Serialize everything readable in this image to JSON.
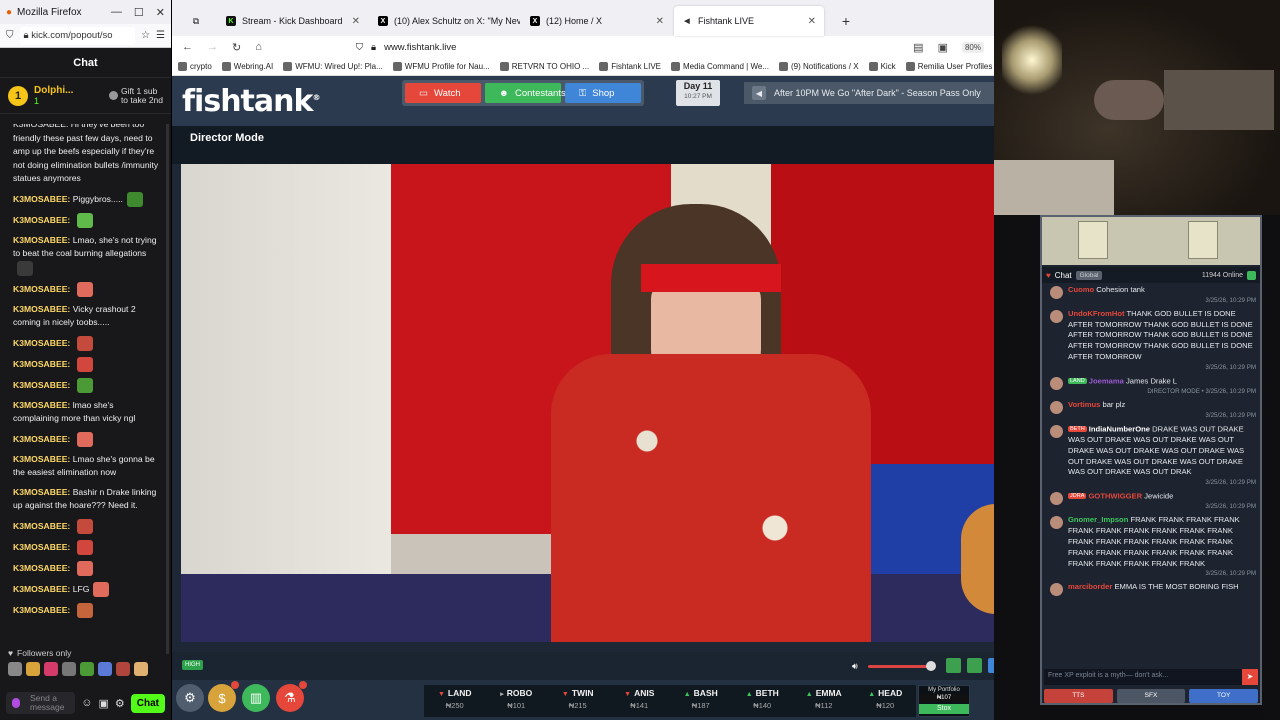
{
  "kick_window": {
    "title": "Mozilla Firefox",
    "url": "kick.com/popout/so",
    "header": "Chat",
    "pinned": {
      "badge": "1",
      "user": "Dolphi...",
      "count": "1",
      "gift_line1": "Gift 1 sub",
      "gift_line2": "to take 2nd"
    },
    "messages": [
      {
        "user": "",
        "text": "friendly these past few days, need to amp up the beefs especially if they're not doing elimination bullets /immunity statues anymores",
        "emote": "",
        "partial": "K3MOSABEE: Hi they've been too"
      },
      {
        "user": "K3MOSABEE:",
        "text": "Piggybros.....",
        "emote": "#3f8a2f"
      },
      {
        "user": "K3MOSABEE:",
        "text": "",
        "emote": "#5fba4a"
      },
      {
        "user": "K3MOSABEE:",
        "text": "Lmao, she's not trying to beat the coal burning allegations",
        "emote": "#3a3a3a"
      },
      {
        "user": "K3MOSABEE:",
        "text": "",
        "emote": "#e06b5c"
      },
      {
        "user": "K3MOSABEE:",
        "text": "Vicky crashout 2 coming in nicely toobs.....",
        "emote": ""
      },
      {
        "user": "K3MOSABEE:",
        "text": "",
        "emote": "#c44a3b"
      },
      {
        "user": "K3MOSABEE:",
        "text": "",
        "emote": "#d2473d"
      },
      {
        "user": "K3MOSABEE:",
        "text": "",
        "emote": "#4c9a36"
      },
      {
        "user": "K3MOSABEE:",
        "text": "lmao she's complaining more than vicky ngl",
        "emote": ""
      },
      {
        "user": "K3MOSABEE:",
        "text": "",
        "emote": "#e06b5c"
      },
      {
        "user": "K3MOSABEE:",
        "text": "Lmao she's gonna be the easiest elimination now",
        "emote": ""
      },
      {
        "user": "K3MOSABEE:",
        "text": "Bashir n Drake linking up against the hoare??? Need it.",
        "emote": ""
      },
      {
        "user": "K3MOSABEE:",
        "text": "",
        "emote": "#c44a3b"
      },
      {
        "user": "K3MOSABEE:",
        "text": "",
        "emote": "#d2473d"
      },
      {
        "user": "K3MOSABEE:",
        "text": "",
        "emote": "#e06b5c"
      },
      {
        "user": "K3MOSABEE:",
        "text": "LFG",
        "emote": "#e06b5c"
      },
      {
        "user": "K3MOSABEE:",
        "text": "",
        "emote": "#c4653b"
      }
    ],
    "followers_only": "Followers only",
    "send_placeholder": "Send a message",
    "chat_button": "Chat"
  },
  "main_window": {
    "tabs": [
      {
        "label": "Stream - Kick Dashboard",
        "icon": "K"
      },
      {
        "label": "(10) Alex Schultz on X: \"My Nev",
        "icon": "X"
      },
      {
        "label": "(12) Home / X",
        "icon": "X"
      },
      {
        "label": "Fishtank LIVE",
        "icon": "◀"
      }
    ],
    "url": "www.fishtank.live",
    "zoom": "80%",
    "bookmarks": [
      "crypto",
      "Webring.AI",
      "WFMU: Wired Up!: Pla...",
      "WFMU Profile for Nau...",
      "RETVRN TO OHIO ...",
      "Fishtank LIVE",
      "Media Command | We...",
      "(9) Notifications / X",
      "Kick",
      "Remilia User Profiles"
    ],
    "site": {
      "logo": "fishtank",
      "watch": "Watch",
      "contestants": "Contestants",
      "shop": "Shop",
      "day": "Day 11",
      "time": "10:27 PM",
      "ticker": "After 10PM We Go \"After Dark\" - Season Pass Only",
      "director_mode": "Director Mode",
      "hd": "HIGH"
    },
    "stocks": [
      {
        "name": "LAND",
        "price": "₦250",
        "dir": "down"
      },
      {
        "name": "ROBO",
        "price": "₦101",
        "dir": "flat"
      },
      {
        "name": "TWIN",
        "price": "₦215",
        "dir": "down"
      },
      {
        "name": "ANIS",
        "price": "₦141",
        "dir": "down"
      },
      {
        "name": "BASH",
        "price": "₦187",
        "dir": "up"
      },
      {
        "name": "BETH",
        "price": "₦140",
        "dir": "up"
      },
      {
        "name": "EMMA",
        "price": "₦112",
        "dir": "up"
      },
      {
        "name": "HEAD",
        "price": "₦120",
        "dir": "up"
      }
    ],
    "portfolio": {
      "label": "My Portfolio",
      "value": "₦107",
      "button": "Stox"
    }
  },
  "fishtank_chat": {
    "title": "Chat",
    "global": "Global",
    "online": "11944 Online",
    "messages": [
      {
        "user": "Cuomo",
        "user_color": "#e5473b",
        "tag": "",
        "tag_color": "",
        "text": "Cohesion tank",
        "ts": "3/25/26, 10:29 PM"
      },
      {
        "user": "UndoKFromHot",
        "user_color": "#e5473b",
        "tag": "",
        "tag_color": "",
        "text": "THANK GOD BULLET IS DONE AFTER TOMORROW THANK GOD BULLET IS DONE AFTER TOMORROW THANK GOD BULLET IS DONE AFTER TOMORROW THANK GOD BULLET IS DONE AFTER TOMORROW",
        "ts": "3/25/26, 10:29 PM"
      },
      {
        "user": "Joemama",
        "user_color": "#9b59d0",
        "tag": "LAND",
        "tag_color": "#3db85a",
        "text": "James Drake L",
        "ts": "DIRECTOR MODE • 3/25/26, 10:29 PM"
      },
      {
        "user": "Vortimus",
        "user_color": "#e5473b",
        "tag": "",
        "tag_color": "",
        "text": "bar plz",
        "ts": "3/25/26, 10:29 PM"
      },
      {
        "user": "IndiaNumberOne",
        "user_color": "#ffffff",
        "tag": "BETH",
        "tag_color": "#e5473b",
        "text": "DRAKE WAS OUT DRAKE WAS OUT DRAKE WAS OUT DRAKE WAS OUT DRAKE WAS OUT DRAKE WAS OUT DRAKE WAS OUT DRAKE WAS OUT DRAKE WAS OUT DRAKE WAS OUT DRAKE WAS OUT DRAK",
        "ts": "3/25/26, 10:29 PM"
      },
      {
        "user": "GOTHWIGGER",
        "user_color": "#e5473b",
        "tag": "JDRA",
        "tag_color": "#e5473b",
        "text": "Jewicide",
        "ts": "3/25/26, 10:29 PM"
      },
      {
        "user": "Gnomer_Impson",
        "user_color": "#3ec65e",
        "tag": "",
        "tag_color": "",
        "text": "FRANK FRANK FRANK FRANK FRANK FRANK FRANK FRANK FRANK FRANK FRANK FRANK FRANK FRANK FRANK FRANK FRANK FRANK FRANK FRANK FRANK FRANK FRANK FRANK FRANK FRANK FRANK",
        "ts": "3/25/26, 10:29 PM"
      },
      {
        "user": "marciborder",
        "user_color": "#e5473b",
        "tag": "",
        "tag_color": "",
        "text": "EMMA IS THE MOST BORING FISH",
        "ts": ""
      }
    ],
    "placeholder": "Free XP exploit is a myth— don't ask...",
    "tts": "TTS",
    "sfx": "SFX",
    "toy": "TOY"
  }
}
